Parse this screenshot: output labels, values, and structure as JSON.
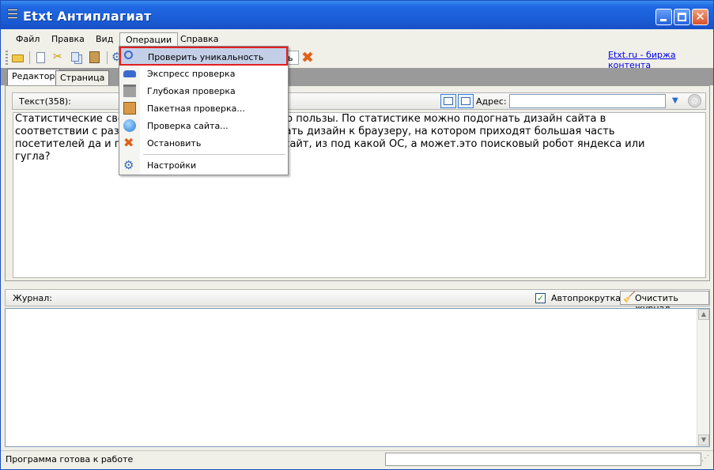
{
  "window": {
    "title": "Etxt Антиплагиат"
  },
  "menubar": {
    "items": [
      "Файл",
      "Правка",
      "Вид",
      "Операции",
      "Справка"
    ],
    "active": "Операции"
  },
  "toolbar": {
    "field_fragment": "ь",
    "link": "Etxt.ru - биржа контента"
  },
  "tabs": [
    "Редактор",
    "Страница"
  ],
  "editor": {
    "text_label": "Текст(358):",
    "address_label": "Адрес:",
    "address_value": "",
    "lines": [
      "Статистические све                              осят не мало пользы. По статистике можно подогнать дизайн сайта в",
      "соответствии с разр                             лей, подогнать дизайн к браузеру, на котором приходят большая часть",
      "посетителей да и пр                              т к вам на сайт, из под какой ОС, а может.это поисковый робот яндекса или",
      "гугла?"
    ]
  },
  "operations_menu": {
    "items": [
      {
        "label": "Проверить уникальность",
        "icon": "magnifier-icon",
        "highlighted": true
      },
      {
        "label": "Экспресс проверка",
        "icon": "car-icon"
      },
      {
        "label": "Глубокая проверка",
        "icon": "bank-icon"
      },
      {
        "label": "Пакетная проверка...",
        "icon": "package-icon"
      },
      {
        "label": "Проверка сайта...",
        "icon": "globe-icon"
      },
      {
        "label": "Остановить",
        "icon": "stop-x-icon"
      },
      {
        "label": "Настройки",
        "icon": "settings-icon"
      }
    ]
  },
  "journal": {
    "label": "Журнал:",
    "autoscroll_label": "Автопрокрутка",
    "autoscroll_checked": true,
    "clear_label": "Очистить журнал"
  },
  "status": {
    "text": "Программа готова к работе"
  },
  "colors": {
    "titlebar": "#1a5fd8",
    "menu_highlight": "#c3cfe6",
    "highlight_outline": "#e02020"
  }
}
